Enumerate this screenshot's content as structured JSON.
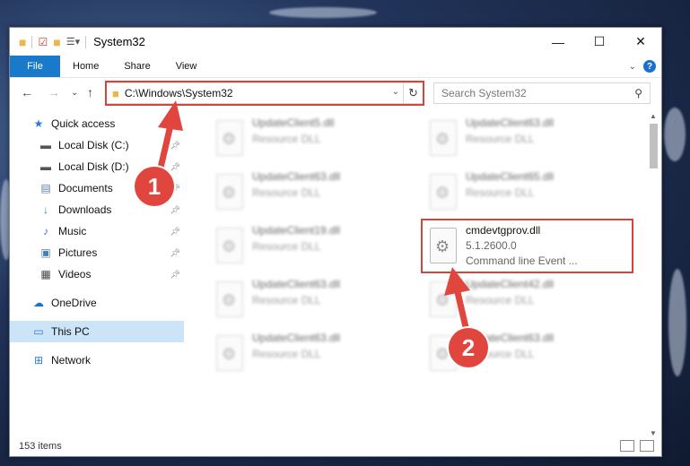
{
  "window": {
    "title": "System32",
    "controls": {
      "minimize": "—",
      "maximize": "☐",
      "close": "✕"
    }
  },
  "ribbon": {
    "file": "File",
    "tabs": [
      "Home",
      "Share",
      "View"
    ],
    "help": "?"
  },
  "navbar": {
    "address": "C:\\Windows\\System32",
    "search_placeholder": "Search System32"
  },
  "sidebar": {
    "items": [
      {
        "label": "Quick access",
        "icon": "star-icon",
        "pinned": false
      },
      {
        "label": "Local Disk (C:)",
        "icon": "drive-icon",
        "pinned": true
      },
      {
        "label": "Local Disk (D:)",
        "icon": "drive-icon",
        "pinned": true
      },
      {
        "label": "Documents",
        "icon": "documents-icon",
        "pinned": true
      },
      {
        "label": "Downloads",
        "icon": "downloads-icon",
        "pinned": true
      },
      {
        "label": "Music",
        "icon": "music-icon",
        "pinned": true
      },
      {
        "label": "Pictures",
        "icon": "pictures-icon",
        "pinned": true
      },
      {
        "label": "Videos",
        "icon": "videos-icon",
        "pinned": true
      },
      {
        "label": "OneDrive",
        "icon": "onedrive-icon",
        "pinned": false
      },
      {
        "label": "This PC",
        "icon": "this-pc-icon",
        "pinned": false,
        "selected": true
      },
      {
        "label": "Network",
        "icon": "network-icon",
        "pinned": false
      }
    ]
  },
  "files": [
    {
      "name": "UpdateClient5.dll",
      "type": "Resource DLL",
      "blurred": true
    },
    {
      "name": "UpdateClient63.dll",
      "type": "Resource DLL",
      "blurred": true
    },
    {
      "name": "UpdateClient63.dll",
      "type": "Resource DLL",
      "blurred": true
    },
    {
      "name": "UpdateClient65.dll",
      "type": "Resource DLL",
      "blurred": true
    },
    {
      "name": "UpdateClient19.dll",
      "type": "Resource DLL",
      "blurred": true
    },
    {
      "name": "cmdevtgprov.dll",
      "version": "5.1.2600.0",
      "type": "Command line Event ...",
      "blurred": false,
      "highlighted": true
    },
    {
      "name": "UpdateClient63.dll",
      "type": "Resource DLL",
      "blurred": true
    },
    {
      "name": "UpdateClient42.dll",
      "type": "Resource DLL",
      "blurred": true
    },
    {
      "name": "UpdateClient63.dll",
      "type": "Resource DLL",
      "blurred": true
    },
    {
      "name": "UpdateClient63.dll",
      "type": "Resource DLL",
      "blurred": true
    }
  ],
  "status": {
    "items": "153 items"
  },
  "callouts": {
    "one": "1",
    "two": "2"
  },
  "colors": {
    "accent": "#1979ca",
    "highlight": "#d0453c",
    "callout": "#e0463e",
    "selected": "#cce4f7"
  }
}
